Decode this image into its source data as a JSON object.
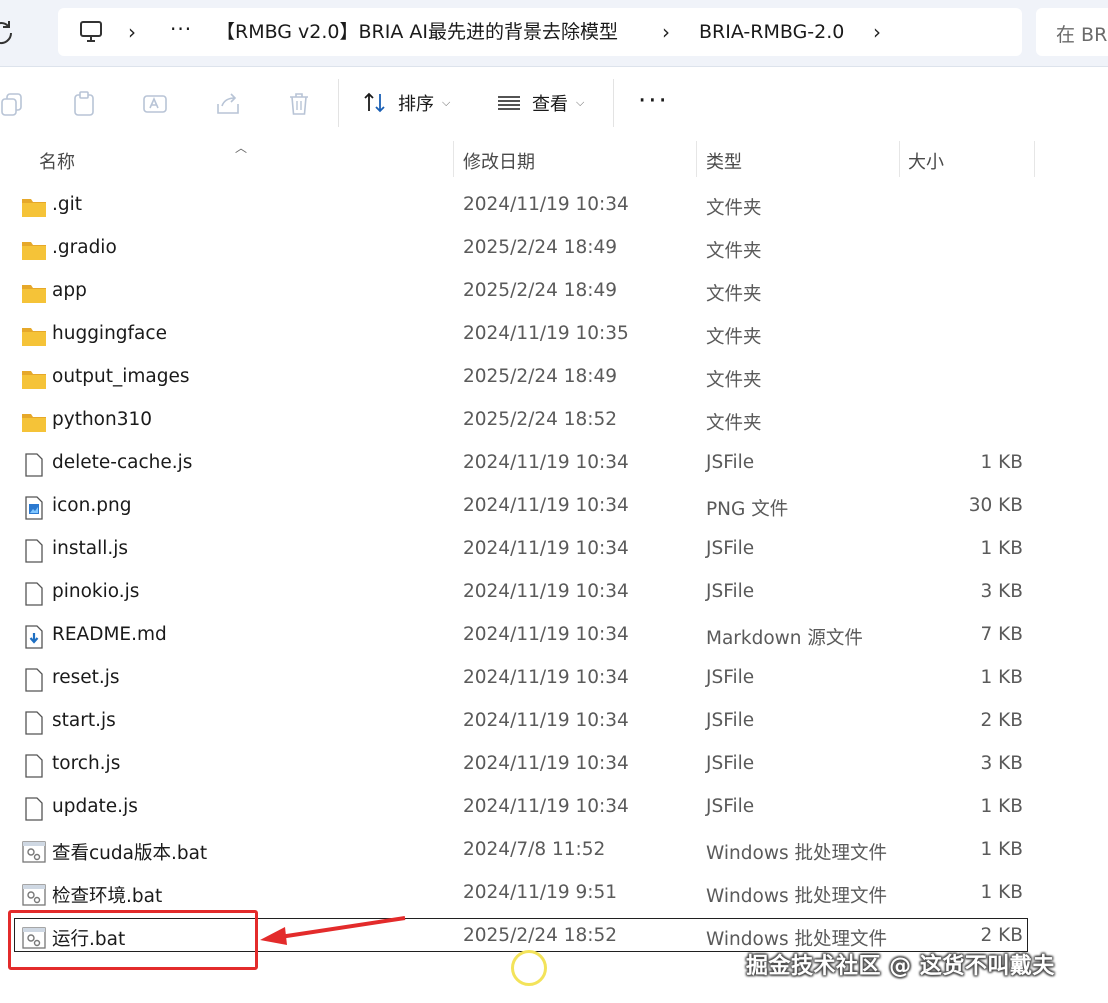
{
  "address_bar": {
    "more_label": "···",
    "crumbs": [
      "【RMBG v2.0】BRIA AI最先进的背景去除模型",
      "BRIA-RMBG-2.0"
    ],
    "search_placeholder": "在 BRI"
  },
  "toolbar": {
    "sort_label": "排序",
    "view_label": "查看",
    "more_label": "···"
  },
  "columns": {
    "name": "名称",
    "date": "修改日期",
    "type": "类型",
    "size": "大小"
  },
  "files": [
    {
      "name": ".git",
      "date": "2024/11/19 10:34",
      "type": "文件夹",
      "size": "",
      "icon": "folder-icon"
    },
    {
      "name": ".gradio",
      "date": "2025/2/24 18:49",
      "type": "文件夹",
      "size": "",
      "icon": "folder-icon"
    },
    {
      "name": "app",
      "date": "2025/2/24 18:49",
      "type": "文件夹",
      "size": "",
      "icon": "folder-icon"
    },
    {
      "name": "huggingface",
      "date": "2024/11/19 10:35",
      "type": "文件夹",
      "size": "",
      "icon": "folder-icon"
    },
    {
      "name": "output_images",
      "date": "2025/2/24 18:49",
      "type": "文件夹",
      "size": "",
      "icon": "folder-icon"
    },
    {
      "name": "python310",
      "date": "2025/2/24 18:52",
      "type": "文件夹",
      "size": "",
      "icon": "folder-icon"
    },
    {
      "name": "delete-cache.js",
      "date": "2024/11/19 10:34",
      "type": "JSFile",
      "size": "1 KB",
      "icon": "file-icon"
    },
    {
      "name": "icon.png",
      "date": "2024/11/19 10:34",
      "type": "PNG 文件",
      "size": "30 KB",
      "icon": "image-file-icon"
    },
    {
      "name": "install.js",
      "date": "2024/11/19 10:34",
      "type": "JSFile",
      "size": "1 KB",
      "icon": "file-icon"
    },
    {
      "name": "pinokio.js",
      "date": "2024/11/19 10:34",
      "type": "JSFile",
      "size": "3 KB",
      "icon": "file-icon"
    },
    {
      "name": "README.md",
      "date": "2024/11/19 10:34",
      "type": "Markdown 源文件",
      "size": "7 KB",
      "icon": "markdown-file-icon"
    },
    {
      "name": "reset.js",
      "date": "2024/11/19 10:34",
      "type": "JSFile",
      "size": "1 KB",
      "icon": "file-icon"
    },
    {
      "name": "start.js",
      "date": "2024/11/19 10:34",
      "type": "JSFile",
      "size": "2 KB",
      "icon": "file-icon"
    },
    {
      "name": "torch.js",
      "date": "2024/11/19 10:34",
      "type": "JSFile",
      "size": "3 KB",
      "icon": "file-icon"
    },
    {
      "name": "update.js",
      "date": "2024/11/19 10:34",
      "type": "JSFile",
      "size": "1 KB",
      "icon": "file-icon"
    },
    {
      "name": "查看cuda版本.bat",
      "date": "2024/7/8 11:52",
      "type": "Windows 批处理文件",
      "size": "1 KB",
      "icon": "batch-file-icon"
    },
    {
      "name": "检查环境.bat",
      "date": "2024/11/19 9:51",
      "type": "Windows 批处理文件",
      "size": "1 KB",
      "icon": "batch-file-icon"
    },
    {
      "name": "运行.bat",
      "date": "2025/2/24 18:52",
      "type": "Windows 批处理文件",
      "size": "2 KB",
      "icon": "batch-file-icon",
      "selected": true
    }
  ],
  "watermark": "掘金技术社区 @ 这货不叫戴夫",
  "colors": {
    "address_bg": "#f0f3f9",
    "highlight_red": "#e32b2b",
    "folder_yellow": "#f5c338",
    "cursor_ring": "#f3e35a"
  }
}
